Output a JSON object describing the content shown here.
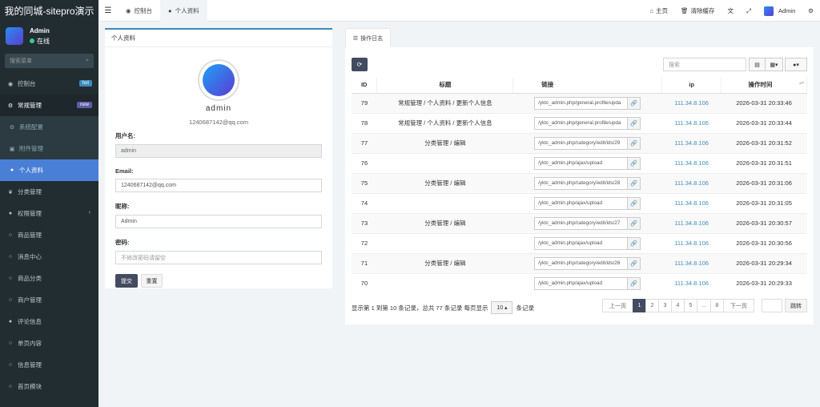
{
  "brand": "我的同城-sitepro演示",
  "user": {
    "name": "Admin",
    "status": "在线"
  },
  "sidebar": {
    "search_placeholder": "搜索菜单",
    "items": [
      {
        "label": "控制台",
        "badge": "hot",
        "badge_color": "#3c8dbc"
      },
      {
        "label": "常规管理",
        "badge": "new",
        "badge_color": "#605ca8"
      },
      {
        "label": "系统配置"
      },
      {
        "label": "附件管理"
      },
      {
        "label": "个人资料"
      },
      {
        "label": "分类管理"
      },
      {
        "label": "权限管理"
      },
      {
        "label": "商品管理"
      },
      {
        "label": "消息中心"
      },
      {
        "label": "商品分类"
      },
      {
        "label": "商户管理"
      },
      {
        "label": "评论信息"
      },
      {
        "label": "单页内容"
      },
      {
        "label": "信息管理"
      },
      {
        "label": "首页模块"
      }
    ]
  },
  "topbar": {
    "tabs": [
      "控制台",
      "个人资料"
    ],
    "home": "主页",
    "clear_cache": "清除缓存",
    "admin": "Admin"
  },
  "profile": {
    "title": "个人资料",
    "name": "admin",
    "email": "1240687142@qq.com",
    "fields": {
      "username_label": "用户名:",
      "username_value": "admin",
      "email_label": "Email:",
      "email_value": "1240687142@qq.com",
      "nickname_label": "昵称:",
      "nickname_value": "Admin",
      "password_label": "密码:",
      "password_placeholder": "不修改密码请留空"
    },
    "submit": "提交",
    "reset": "重置"
  },
  "log": {
    "tab": "操作日志",
    "search_placeholder": "搜索",
    "headers": [
      "ID",
      "标题",
      "链接",
      "ip",
      "操作时间"
    ],
    "rows": [
      {
        "id": "79",
        "title": "常规管理 / 个人资料 / 更新个人信息",
        "url": "/yktc_admin.php/general.profile/upda",
        "ip": "111.34.8.106",
        "time": "2026-03-31 20:33:46"
      },
      {
        "id": "78",
        "title": "常规管理 / 个人资料 / 更新个人信息",
        "url": "/yktc_admin.php/general.profile/upda",
        "ip": "111.34.8.106",
        "time": "2026-03-31 20:33:44"
      },
      {
        "id": "77",
        "title": "分类管理 / 编辑",
        "url": "/yktc_admin.php/category/edit/ids/29",
        "ip": "111.34.8.106",
        "time": "2026-03-31 20:31:52"
      },
      {
        "id": "76",
        "title": "",
        "url": "/yktc_admin.php/ajax/upload",
        "ip": "111.34.8.106",
        "time": "2026-03-31 20:31:51"
      },
      {
        "id": "75",
        "title": "分类管理 / 编辑",
        "url": "/yktc_admin.php/category/edit/ids/28",
        "ip": "111.34.8.106",
        "time": "2026-03-31 20:31:06"
      },
      {
        "id": "74",
        "title": "",
        "url": "/yktc_admin.php/ajax/upload",
        "ip": "111.34.8.106",
        "time": "2026-03-31 20:31:05"
      },
      {
        "id": "73",
        "title": "分类管理 / 编辑",
        "url": "/yktc_admin.php/category/edit/ids/27",
        "ip": "111.34.8.106",
        "time": "2026-03-31 20:30:57"
      },
      {
        "id": "72",
        "title": "",
        "url": "/yktc_admin.php/ajax/upload",
        "ip": "111.34.8.106",
        "time": "2026-03-31 20:30:56"
      },
      {
        "id": "71",
        "title": "分类管理 / 编辑",
        "url": "/yktc_admin.php/category/edit/ids/26",
        "ip": "111.34.8.106",
        "time": "2026-03-31 20:29:34"
      },
      {
        "id": "70",
        "title": "",
        "url": "/yktc_admin.php/ajax/upload",
        "ip": "111.34.8.106",
        "time": "2026-03-31 20:29:33"
      }
    ],
    "footer_prefix": "显示第 1 到第 10 条记录，总共 77 条记录 每页显示",
    "page_size": "10",
    "footer_suffix": "条记录",
    "pager": [
      "上一页",
      "1",
      "2",
      "3",
      "4",
      "5",
      "...",
      "8",
      "下一页"
    ],
    "jump": "跳转"
  }
}
